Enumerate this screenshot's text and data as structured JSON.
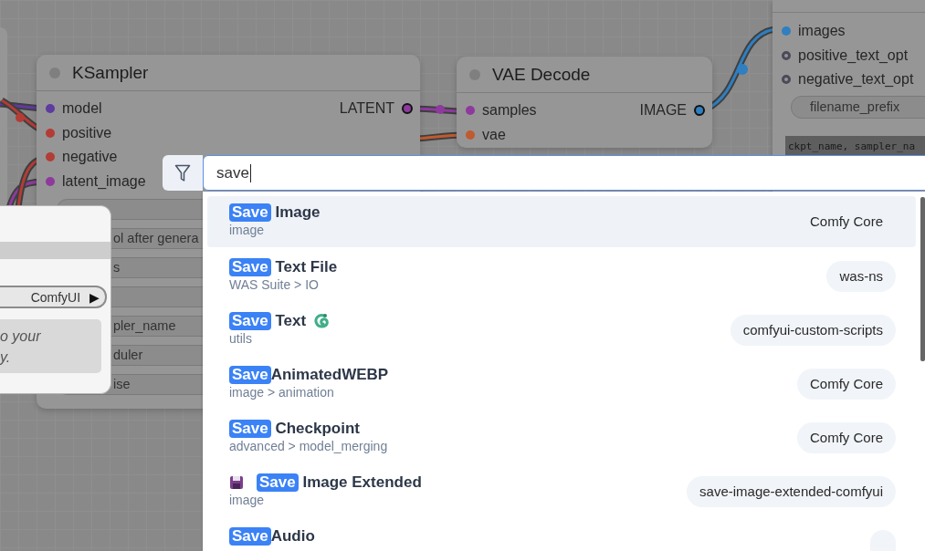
{
  "canvas": {
    "nodes": [
      {
        "title": "KSampler",
        "inputs": [
          {
            "name": "model",
            "color": "#5e3b9e",
            "optional": false
          },
          {
            "name": "positive",
            "color": "#b33c36",
            "optional": false
          },
          {
            "name": "negative",
            "color": "#b33c36",
            "optional": false
          },
          {
            "name": "latent_image",
            "color": "#8e3a9c",
            "optional": false
          }
        ],
        "outputs": [
          {
            "name": "LATENT",
            "color": "#8e3a9c"
          }
        ],
        "widgets": [
          {
            "kind": "field"
          },
          {
            "kind": "field",
            "label": "ol after genera"
          },
          {
            "kind": "field",
            "label": "s"
          },
          {
            "kind": "field"
          },
          {
            "kind": "field",
            "label": "pler_name"
          },
          {
            "kind": "field",
            "label": "duler"
          },
          {
            "kind": "field",
            "label": "ise"
          }
        ]
      },
      {
        "title": "VAE Decode",
        "inputs": [
          {
            "name": "samples",
            "color": "#8e3a9c",
            "optional": false
          },
          {
            "name": "vae",
            "color": "#c05a30",
            "optional": false
          }
        ],
        "outputs": [
          {
            "name": "IMAGE",
            "color": "#2f7fc1"
          }
        ]
      },
      {
        "inputs": [
          {
            "name": "images",
            "color": "#2f7fc1",
            "optional": false
          },
          {
            "name": "positive_text_opt",
            "color": "#4a4a58",
            "optional": true
          },
          {
            "name": "negative_text_opt",
            "color": "#4a4a58",
            "optional": true
          }
        ],
        "widgets": [
          {
            "kind": "field",
            "label": "filename_prefix"
          },
          {
            "kind": "textbox",
            "label": "ckpt_name, sampler_na"
          }
        ]
      }
    ]
  },
  "side_menu": {
    "dropdown": {
      "label": "ComfyUI",
      "arrow": "▶"
    },
    "note": "o your\ny."
  },
  "search": {
    "query": "save",
    "results": [
      {
        "match": "Save",
        "name": " Image",
        "category": "image",
        "source": "Comfy Core",
        "selected": true
      },
      {
        "match": "Save",
        "name": " Text File",
        "category": "WAS Suite > IO",
        "source": "was-ns",
        "selected": false
      },
      {
        "match": "Save",
        "name": " Text",
        "category": "utils",
        "source": "comfyui-custom-scripts",
        "selected": false,
        "kind": "suffixed"
      },
      {
        "match": "Save",
        "name": "AnimatedWEBP",
        "category": "image > animation",
        "source": "Comfy Core",
        "selected": false
      },
      {
        "match": "Save",
        "name": " Checkpoint",
        "category": "advanced > model_merging",
        "source": "Comfy Core",
        "selected": false
      },
      {
        "match": "Save",
        "name": " Image Extended",
        "category": "image",
        "source": "save-image-extended-comfyui",
        "selected": false,
        "kind": "prefixed"
      },
      {
        "match": "Save",
        "name": "Audio",
        "selected": false
      }
    ]
  }
}
